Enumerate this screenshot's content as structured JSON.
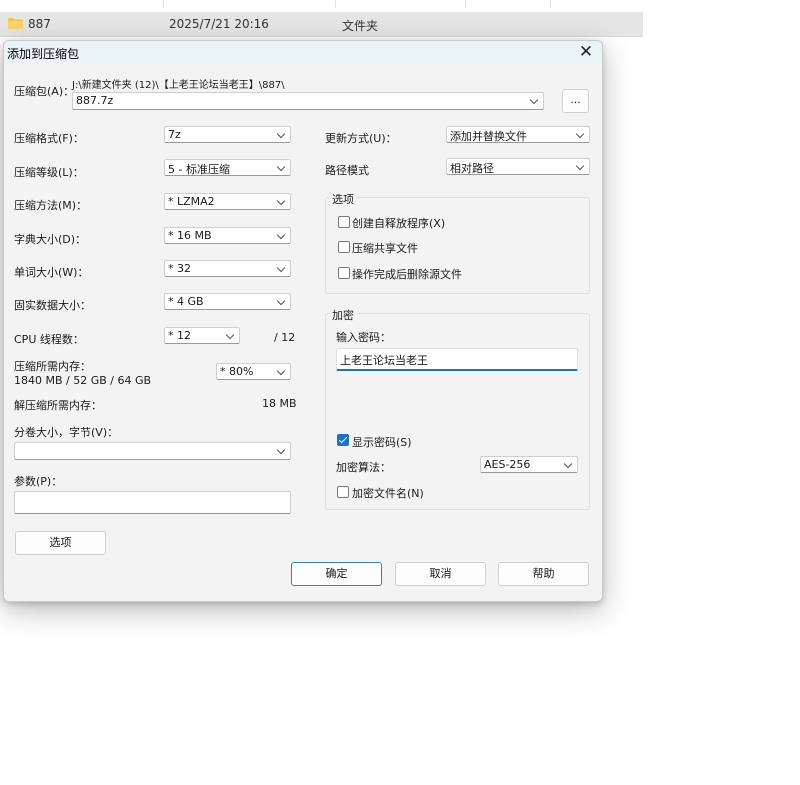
{
  "explorer": {
    "name": "887",
    "date": "2025/7/21 20:16",
    "type": "文件夹"
  },
  "dialog": {
    "title": "添加到压缩包",
    "archive_label": "压缩包(A)：",
    "archive_path": "J:\\新建文件夹 (12)\\【上老王论坛当老王】\\887\\",
    "archive_name": "887.7z",
    "browse_label": "...",
    "format_label": "压缩格式(F)：",
    "format_value": "7z",
    "level_label": "压缩等级(L)：",
    "level_value": "5 - 标准压缩",
    "method_label": "压缩方法(M)：",
    "method_value": "*  LZMA2",
    "dict_label": "字典大小(D)：",
    "dict_value": "*  16 MB",
    "word_label": "单词大小(W)：",
    "word_value": "*  32",
    "solid_label": "固实数据大小：",
    "solid_value": "*  4 GB",
    "cpu_label": "CPU 线程数：",
    "cpu_value": "*  12",
    "cpu_total": "/ 12",
    "mem_label": "压缩所需内存：",
    "mem_value": "1840 MB / 52 GB / 64 GB",
    "mem_percent": "*  80%",
    "decomp_label": "解压缩所需内存：",
    "decomp_value": "18 MB",
    "volume_label": "分卷大小，字节(V)：",
    "volume_value": "",
    "params_label": "参数(P)：",
    "params_value": "",
    "options_button": "选项",
    "update_label": "更新方式(U)：",
    "update_value": "添加并替换文件",
    "path_label": "路径模式",
    "path_value": "相对路径",
    "options_group": {
      "title": "选项",
      "sfx": "创建自释放程序(X)",
      "shared": "压缩共享文件",
      "delete": "操作完成后删除源文件"
    },
    "encrypt_group": {
      "title": "加密",
      "password_label": "输入密码：",
      "password_value": "上老王论坛当老王",
      "show_password": "显示密码(S)",
      "algo_label": "加密算法：",
      "algo_value": "AES-256",
      "encrypt_names": "加密文件名(N)"
    },
    "ok_button": "确定",
    "cancel_button": "取消",
    "help_button": "帮助"
  },
  "colors": {
    "accent": "#1f6fc5",
    "titlebar": "#eaf3f6",
    "dialog_bg": "#f3f3f3",
    "folder": "#f2c14e"
  }
}
